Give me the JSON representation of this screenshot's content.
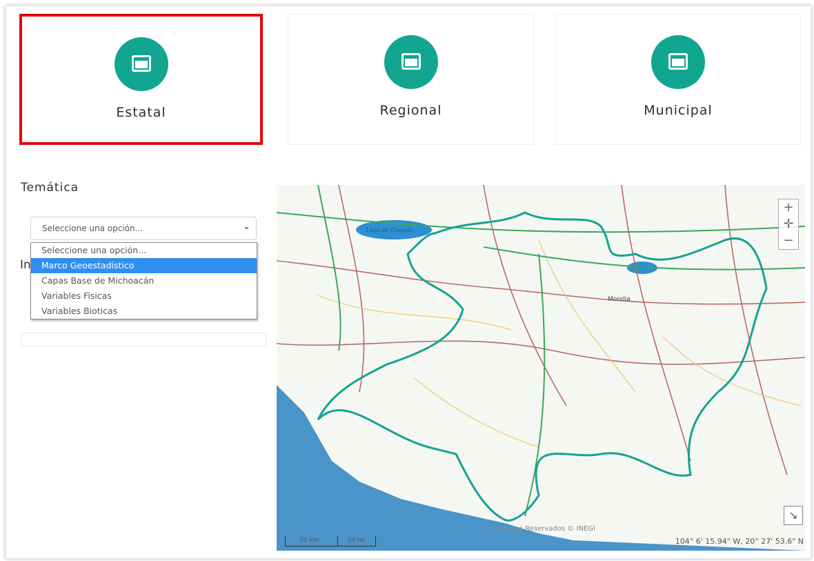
{
  "cards": [
    {
      "label": "Estatal",
      "icon": "window-icon",
      "selected": true
    },
    {
      "label": "Regional",
      "icon": "window-icon",
      "selected": false
    },
    {
      "label": "Municipal",
      "icon": "window-icon",
      "selected": false
    }
  ],
  "colors": {
    "accent": "#12a58f",
    "highlight": "#e1070b",
    "selected_option": "#2f8ff0"
  },
  "tematica": {
    "label": "Temática",
    "selected": "Seleccione una opción...",
    "options": [
      "Seleccione una opción...",
      "Marco Geoestadístico",
      "Capas Base de Michoacán",
      "Variables Fisicas",
      "Variables Bioticas"
    ],
    "highlighted_index": 1
  },
  "second_label_partial": "In",
  "map": {
    "zoom_in": "+",
    "zoom_reset": "✛",
    "zoom_out": "−",
    "credit": "Derechos Reservados © INEGI",
    "coordinates": "104° 6' 15.94\" W, 20° 27' 53.6\" N",
    "scale_km": "50 km",
    "scale_mi": "20 mi",
    "lake_label": "Lago de Chapala",
    "city_label": "Morelia"
  }
}
